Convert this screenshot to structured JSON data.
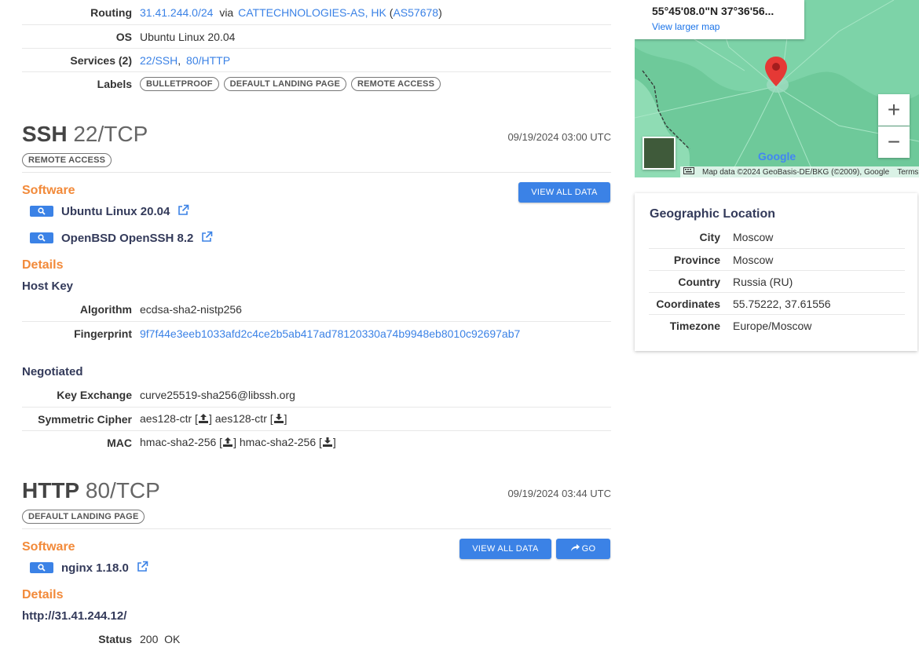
{
  "host": {
    "routing_label": "Routing",
    "routing_net": "31.41.244.0/24",
    "routing_via": "via",
    "routing_org": "CATTECHNOLOGIES-AS, HK",
    "routing_asn": "AS57678",
    "os_label": "OS",
    "os_value": "Ubuntu Linux 20.04",
    "services_label": "Services (2)",
    "services": [
      "22/SSH",
      "80/HTTP"
    ],
    "labels_label": "Labels",
    "labels": [
      "BULLETPROOF",
      "DEFAULT LANDING PAGE",
      "REMOTE ACCESS"
    ]
  },
  "ssh": {
    "proto": "SSH",
    "port": "22/TCP",
    "timestamp": "09/19/2024 03:00 UTC",
    "badge": "REMOTE ACCESS",
    "software_heading": "Software",
    "view_all_label": "VIEW ALL DATA",
    "software": [
      "Ubuntu Linux 20.04",
      "OpenBSD OpenSSH 8.2"
    ],
    "details_heading": "Details",
    "host_key_heading": "Host Key",
    "algorithm_label": "Algorithm",
    "algorithm_value": "ecdsa-sha2-nistp256",
    "fingerprint_label": "Fingerprint",
    "fingerprint_value": "9f7f44e3eeb1033afd2c4ce2b5ab417ad78120330a74b9948eb8010c92697ab7",
    "negotiated_heading": "Negotiated",
    "kex_label": "Key Exchange",
    "kex_value": "curve25519-sha256@libssh.org",
    "cipher_label": "Symmetric Cipher",
    "cipher_up": "aes128-ctr",
    "cipher_down": "aes128-ctr",
    "mac_label": "MAC",
    "mac_up": "hmac-sha2-256",
    "mac_down": "hmac-sha2-256"
  },
  "http": {
    "proto": "HTTP",
    "port": "80/TCP",
    "timestamp": "09/19/2024 03:44 UTC",
    "badge": "DEFAULT LANDING PAGE",
    "software_heading": "Software",
    "view_all_label": "VIEW ALL DATA",
    "go_label": "GO",
    "software": [
      "nginx 1.18.0"
    ],
    "details_heading": "Details",
    "url": "http://31.41.244.12/",
    "status_label": "Status",
    "status_value": "200  OK"
  },
  "map": {
    "coord_text": "55°45'08.0\"N 37°36'56...",
    "larger_map": "View larger map",
    "attribution": "Map data ©2024 GeoBasis-DE/BKG (©2009), Google",
    "terms": "Terms",
    "google": "Google"
  },
  "geo": {
    "title": "Geographic Location",
    "rows": [
      {
        "k": "City",
        "v": "Moscow"
      },
      {
        "k": "Province",
        "v": "Moscow"
      },
      {
        "k": "Country",
        "v": "Russia (RU)"
      },
      {
        "k": "Coordinates",
        "v": "55.75222, 37.61556"
      },
      {
        "k": "Timezone",
        "v": "Europe/Moscow"
      }
    ]
  },
  "colors": {
    "accent": "#3b82e6",
    "orange": "#f28a3a",
    "map_green": "#6fcf9f",
    "pin_red": "#e53935"
  }
}
